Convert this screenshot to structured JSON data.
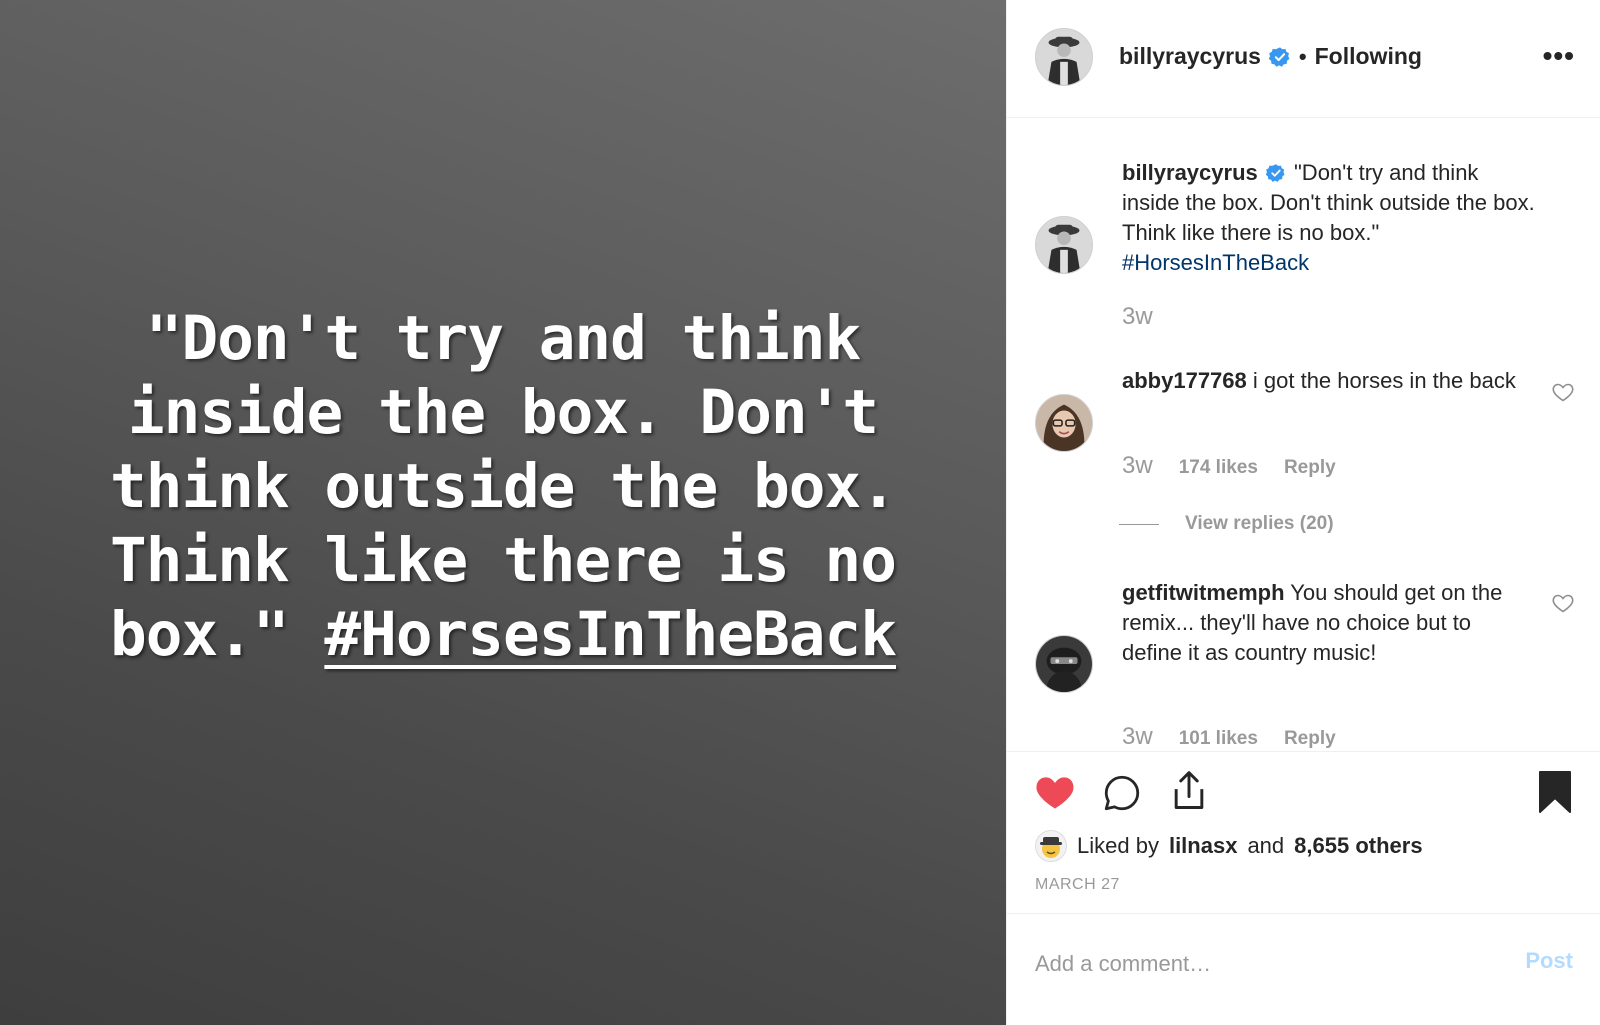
{
  "media": {
    "quote": "\"Don't try and think inside the box. Don't think outside the box. Think like there is no box.\"",
    "hashtag": "#HorsesInTheBack"
  },
  "header": {
    "username": "billyraycyrus",
    "separator": "•",
    "follow_status": "Following",
    "more_label": "•••"
  },
  "caption": {
    "username": "billyraycyrus",
    "text": "\"Don't try and think inside the box. Don't think outside the box. Think like there is no box.\"",
    "hashtag": "#HorsesInTheBack",
    "time": "3w"
  },
  "comments": [
    {
      "username": "abby177768",
      "text": "i got the horses in the back",
      "time": "3w",
      "likes": "174 likes",
      "reply_label": "Reply",
      "view_replies": "View replies (20)"
    },
    {
      "username": "getfitwitmemph",
      "text": "You should get on the remix... they'll have no choice but to define it as country music!",
      "time": "3w",
      "likes": "101 likes",
      "reply_label": "Reply"
    }
  ],
  "actions": {
    "liked_prefix": "Liked by",
    "liked_user": "lilnasx",
    "liked_and": "and",
    "liked_others": "8,655 others",
    "date": "MARCH 27"
  },
  "add_comment": {
    "placeholder": "Add a comment…",
    "post_label": "Post"
  },
  "colors": {
    "like_red": "#ed4956",
    "verified_blue": "#3897f0",
    "hashtag_blue": "#003569",
    "post_disabled": "#b3dbff",
    "muted": "#999999"
  },
  "icons": [
    "heart-icon",
    "comment-icon",
    "share-icon",
    "bookmark-icon",
    "verified-badge-icon",
    "more-options-icon"
  ]
}
